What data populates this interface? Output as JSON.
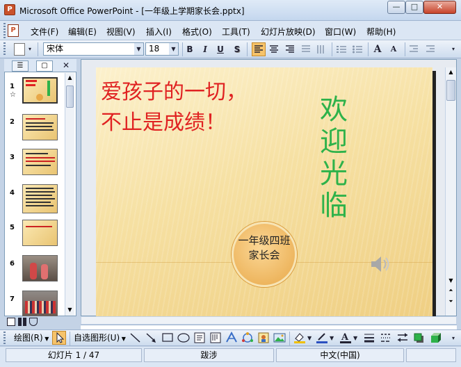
{
  "window": {
    "title": "Microsoft Office PowerPoint - [一年级上学期家长会.pptx]",
    "min_glyph": "—",
    "max_glyph": "□",
    "close_glyph": "✕",
    "app_icon_glyph": "P"
  },
  "menu": {
    "items": [
      "文件(F)",
      "编辑(E)",
      "视图(V)",
      "插入(I)",
      "格式(O)",
      "工具(T)",
      "幻灯片放映(D)",
      "窗口(W)",
      "帮助(H)"
    ]
  },
  "toolbar": {
    "font_name": "宋体",
    "font_size": "18",
    "bold": "B",
    "italic": "I",
    "underline": "U",
    "shadow": "S",
    "grow_font": "A",
    "shrink_font": "A"
  },
  "left_pane": {
    "tab_outline": "☰",
    "tab_slides": "▢",
    "close": "✕",
    "slide_numbers": [
      "1",
      "2",
      "3",
      "4",
      "5",
      "6",
      "7"
    ],
    "star_glyph": "☆"
  },
  "slide": {
    "text_line1": "爱孩子的一切，",
    "text_line2": "不止是成绩！",
    "welcome": "欢迎光临",
    "badge_text": "一年级四班家长会",
    "colors": {
      "red_text": "#e02222",
      "green_text": "#2eb24a"
    }
  },
  "drawing_toolbar": {
    "draw_label": "绘图(R)",
    "autoshapes_label": "自选图形(U)"
  },
  "status": {
    "slide_counter": "幻灯片 1 / 47",
    "design": "跋涉",
    "language": "中文(中国)"
  }
}
